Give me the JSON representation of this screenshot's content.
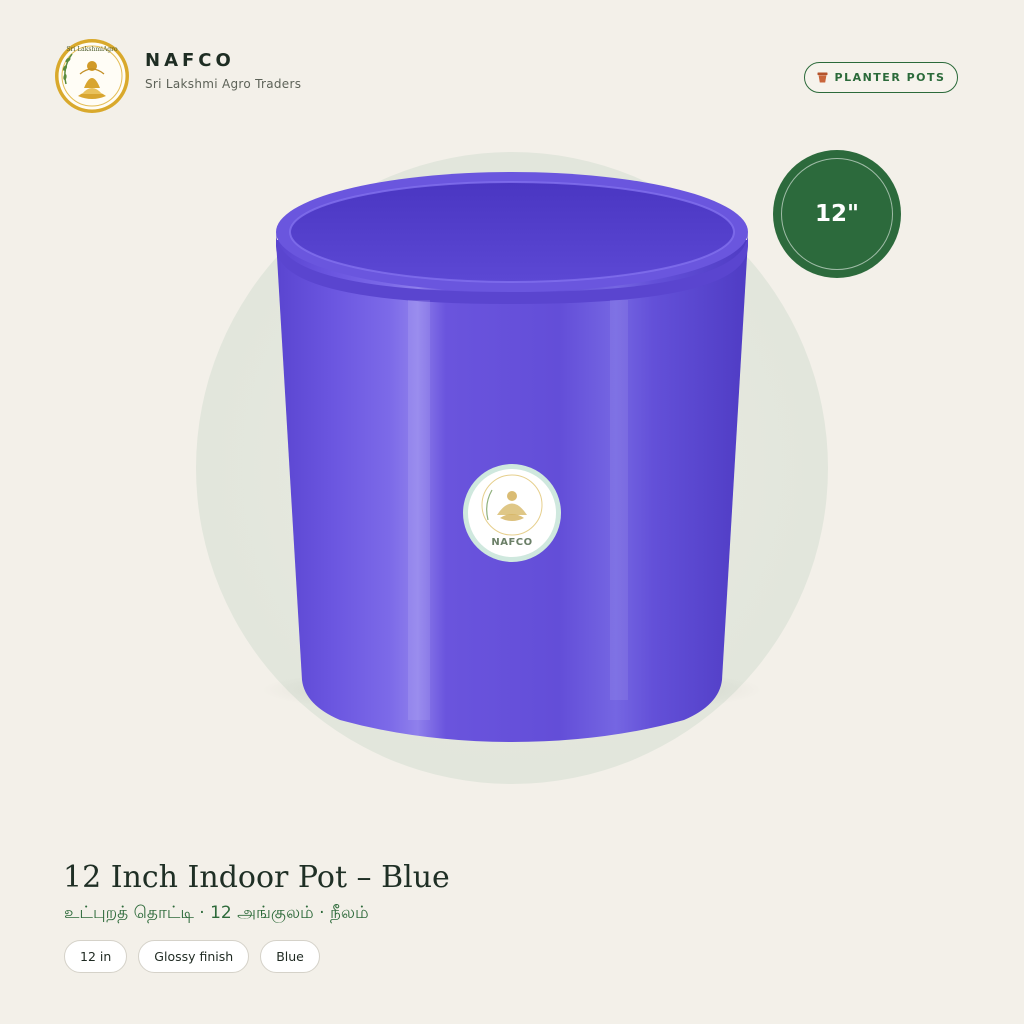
{
  "brand": {
    "name": "NAFCO",
    "tagline": "Sri Lakshmi Agro Traders",
    "logo_text": "Sri LakshmiAgro",
    "logo_icon": "lakshmi-lotus-emblem"
  },
  "category_badge": {
    "icon": "flower-pot-icon",
    "label": "PLANTER POTS"
  },
  "size_badge": {
    "label": "12\""
  },
  "product": {
    "title": "12 Inch Indoor Pot – Blue",
    "subtitle": "உட்புறத் தொட்டி · 12 அங்குலம் · நீலம்",
    "pot_color": "#6650d8",
    "sticker_label": "NAFCO"
  },
  "chips": [
    {
      "label": "12 in"
    },
    {
      "label": "Glossy finish"
    },
    {
      "label": "Blue"
    }
  ],
  "colors": {
    "background": "#f3f0e9",
    "accent_green": "#2c6a3c",
    "pot_blue": "#6650d8"
  }
}
